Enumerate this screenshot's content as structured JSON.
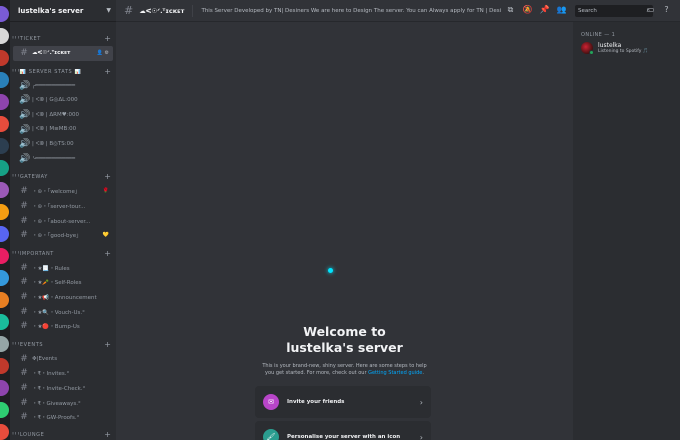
{
  "server": {
    "name": "lustelka's server",
    "chevron": "chevron-down-icon"
  },
  "rail": {
    "colors": [
      "#7a5bd6",
      "#d8d8d8",
      "#c0392b",
      "#2980b9",
      "#8e44ad",
      "#e74c3c",
      "#2c3e50",
      "#16a085",
      "#9b59b6",
      "#f39c12",
      "#5865f2",
      "#e91e63",
      "#3498db",
      "#e67e22",
      "#1abc9c",
      "#95a5a6",
      "#c0392b",
      "#8e44ad",
      "#2ecc71",
      "#e74c3c"
    ]
  },
  "sidebar": {
    "categories": [
      {
        "label": "ꞋꞋꞋTICKET",
        "channels": [
          {
            "icon": "hash-icon",
            "glyph": "#",
            "name": "☁ᐸ☉ᐟ.ᵀɪᴄᴋᴇᴛ",
            "active": true,
            "extra": "👤 ⚙"
          }
        ]
      },
      {
        "label": "ꞋꞋꞋ📊 SERVER STATS 📊",
        "channels": [
          {
            "icon": "speaker-icon",
            "glyph": "🔊",
            "name": "╭════════════",
            "active": false,
            "extra": ""
          },
          {
            "icon": "speaker-icon",
            "glyph": "🔊",
            "name": "| ᐸ⦾ | G◎ΔL:000",
            "active": false,
            "extra": ""
          },
          {
            "icon": "speaker-icon",
            "glyph": "🔊",
            "name": "| ᐸ⦾ | ΔRM♥:000",
            "active": false,
            "extra": ""
          },
          {
            "icon": "speaker-icon",
            "glyph": "🔊",
            "name": "| ᐸ⦾ | M≡MB:00",
            "active": false,
            "extra": ""
          },
          {
            "icon": "speaker-icon",
            "glyph": "🔊",
            "name": "| ᐸ⦾ | B◎TS:00",
            "active": false,
            "extra": ""
          },
          {
            "icon": "speaker-icon",
            "glyph": "🔊",
            "name": "╰════════════",
            "active": false,
            "extra": ""
          }
        ]
      },
      {
        "label": "ꞋꞋꞋGATEWAY",
        "channels": [
          {
            "icon": "hash-icon",
            "glyph": "#",
            "name": "・⊚・「welcome」",
            "active": false,
            "extra": "🌹"
          },
          {
            "icon": "hash-icon",
            "glyph": "#",
            "name": "・⊚・「server-tour...",
            "active": false,
            "extra": ""
          },
          {
            "icon": "hash-icon",
            "glyph": "#",
            "name": "・⊚・「about-server...",
            "active": false,
            "extra": ""
          },
          {
            "icon": "hash-icon",
            "glyph": "#",
            "name": "・⊚・「good-bye」",
            "active": false,
            "extra": "💛"
          }
        ]
      },
      {
        "label": "ꞋꞋꞋIMPORTANT",
        "channels": [
          {
            "icon": "hash-icon",
            "glyph": "#",
            "name": "・★📃・Rules",
            "active": false,
            "extra": ""
          },
          {
            "icon": "hash-icon",
            "glyph": "#",
            "name": "・★🥕・Self-Roles",
            "active": false,
            "extra": ""
          },
          {
            "icon": "hash-icon",
            "glyph": "#",
            "name": "・★📢・Announcement",
            "active": false,
            "extra": ""
          },
          {
            "icon": "hash-icon",
            "glyph": "#",
            "name": "・★🔍・Vouch-Us.°",
            "active": false,
            "extra": ""
          },
          {
            "icon": "hash-icon",
            "glyph": "#",
            "name": "・★🔴・Bump-Us",
            "active": false,
            "extra": ""
          }
        ]
      },
      {
        "label": "ꞋꞋꞋEVENTS",
        "channels": [
          {
            "icon": "hash-icon",
            "glyph": "#",
            "name": "    ✥|Events",
            "active": false,
            "extra": ""
          },
          {
            "icon": "hash-icon",
            "glyph": "#",
            "name": "・₹・Invites.°",
            "active": false,
            "extra": ""
          },
          {
            "icon": "hash-icon",
            "glyph": "#",
            "name": "・₹・Invite-Check.°",
            "active": false,
            "extra": ""
          },
          {
            "icon": "hash-icon",
            "glyph": "#",
            "name": "・₹・Giveaways.°",
            "active": false,
            "extra": ""
          },
          {
            "icon": "hash-icon",
            "glyph": "#",
            "name": "・₹・GW-Proofs.°",
            "active": false,
            "extra": ""
          }
        ]
      },
      {
        "label": "ꞋꞋꞋLOUNGE",
        "channels": []
      }
    ]
  },
  "topbar": {
    "channel_title": "☁ᐸ☉ᐟ.ᵀɪᴄᴋᴇᴛ",
    "topic": "This Server Developed by TN| Desiners We are here to Design The server. You can Always apply for TN | Desiners...",
    "search_placeholder": "Search"
  },
  "members": {
    "group": "ONLINE — 1",
    "list": [
      {
        "name": "lustelka",
        "activity": "Listening to Spotify 🎵"
      }
    ]
  },
  "welcome": {
    "heading_line1": "Welcome to",
    "heading_line2": "lustelka's server",
    "body": "This is your brand-new, shiny server. Here are some steps to help you get started. For more, check out our ",
    "link": "Getting Started guide",
    "body_end": ".",
    "cards": [
      {
        "label": "Invite your friends",
        "icon": "invite-icon",
        "color": "#b845c9"
      },
      {
        "label": "Personalise your server with an icon",
        "icon": "brush-icon",
        "color": "#2a9d8f"
      }
    ]
  },
  "colors": {
    "accent": "#5865f2",
    "online": "#23a55a",
    "link": "#00a8fc",
    "loader": "#00e5ff"
  }
}
